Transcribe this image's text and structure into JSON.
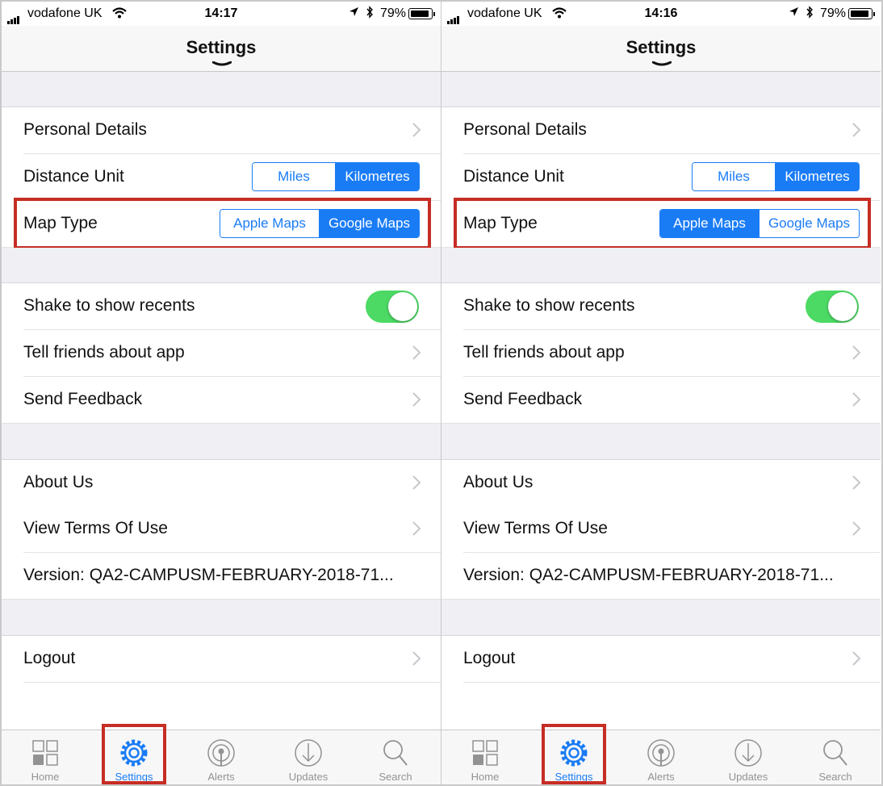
{
  "screens": [
    {
      "status": {
        "carrier": "vodafone UK",
        "time": "14:17",
        "battery": "79%"
      },
      "nav_title": "Settings",
      "rows": {
        "personal_details": "Personal Details",
        "distance_unit": "Distance Unit",
        "distance_options": [
          "Miles",
          "Kilometres"
        ],
        "distance_selected": "Kilometres",
        "map_type": "Map Type",
        "map_options": [
          "Apple Maps",
          "Google Maps"
        ],
        "map_selected": "Google Maps",
        "shake": "Shake to show recents",
        "shake_on": true,
        "tell_friends": "Tell friends about app",
        "send_feedback": "Send Feedback",
        "about_us": "About Us",
        "terms": "View Terms Of Use",
        "version": "Version: QA2-CAMPUSM-FEBRUARY-2018-71...",
        "logout": "Logout"
      },
      "tabs": [
        "Home",
        "Settings",
        "Alerts",
        "Updates",
        "Search"
      ],
      "active_tab": "Settings"
    },
    {
      "status": {
        "carrier": "vodafone UK",
        "time": "14:16",
        "battery": "79%"
      },
      "nav_title": "Settings",
      "rows": {
        "personal_details": "Personal Details",
        "distance_unit": "Distance Unit",
        "distance_options": [
          "Miles",
          "Kilometres"
        ],
        "distance_selected": "Kilometres",
        "map_type": "Map Type",
        "map_options": [
          "Apple Maps",
          "Google Maps"
        ],
        "map_selected": "Apple Maps",
        "shake": "Shake to show recents",
        "shake_on": true,
        "tell_friends": "Tell friends about app",
        "send_feedback": "Send Feedback",
        "about_us": "About Us",
        "terms": "View Terms Of Use",
        "version": "Version: QA2-CAMPUSM-FEBRUARY-2018-71...",
        "logout": "Logout"
      },
      "tabs": [
        "Home",
        "Settings",
        "Alerts",
        "Updates",
        "Search"
      ],
      "active_tab": "Settings"
    }
  ],
  "colors": {
    "accent": "#1a7cf5",
    "toggle_on": "#4cd964",
    "highlight": "#c62d24",
    "group_bg": "#efeff4"
  },
  "icons": [
    "signal-bars-icon",
    "wifi-icon",
    "location-arrow-icon",
    "bluetooth-icon",
    "battery-icon",
    "chevron-right-icon",
    "home-grid-icon",
    "settings-gear-icon",
    "alerts-broadcast-icon",
    "updates-download-icon",
    "search-magnifier-icon"
  ]
}
